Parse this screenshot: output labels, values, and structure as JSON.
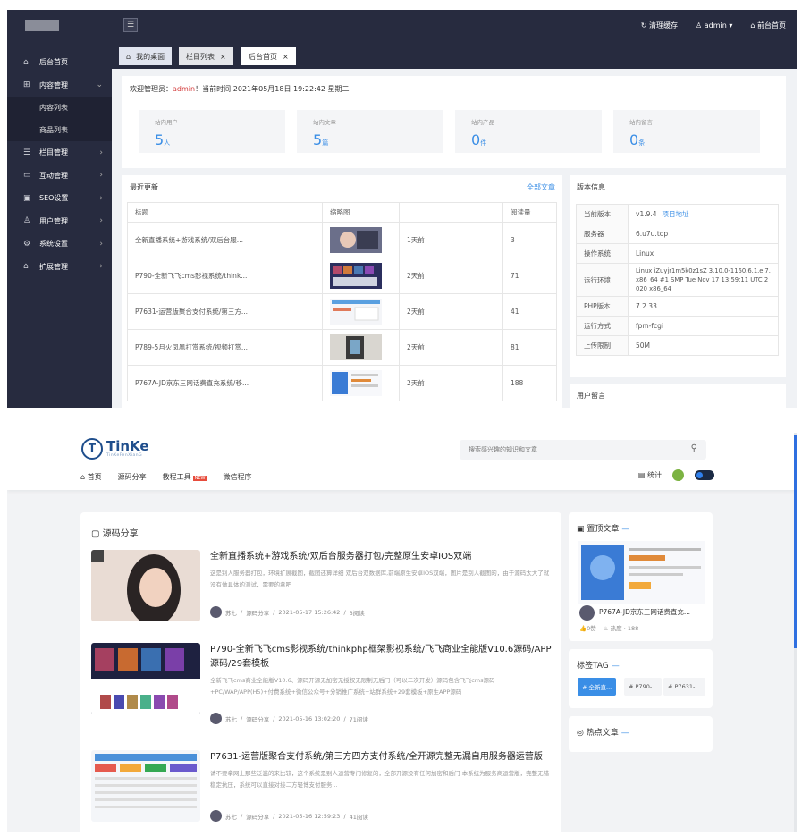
{
  "admin": {
    "topbar": {
      "menu_icon": "menu-icon",
      "clear_cache": "清理缓存",
      "user": "admin",
      "frontend": "前台首页"
    },
    "sidebar": {
      "items": [
        {
          "label": "后台首页",
          "icon": "home-icon"
        },
        {
          "label": "内容管理",
          "icon": "grid-icon",
          "expanded": true
        },
        {
          "label": "内容列表",
          "sub": true
        },
        {
          "label": "商品列表",
          "sub": true
        },
        {
          "label": "栏目管理",
          "icon": "list-icon"
        },
        {
          "label": "互动管理",
          "icon": "chat-icon"
        },
        {
          "label": "SEO设置",
          "icon": "seo-icon"
        },
        {
          "label": "用户管理",
          "icon": "user-icon"
        },
        {
          "label": "系统设置",
          "icon": "gear-icon"
        },
        {
          "label": "扩展管理",
          "icon": "extension-icon"
        }
      ]
    },
    "tabs": [
      {
        "label": "我的桌面"
      },
      {
        "label": "栏目列表"
      },
      {
        "label": "后台首页"
      }
    ],
    "welcome": {
      "prefix": "欢迎管理员：",
      "user": "admin",
      "suffix": "！当前时间:2021年05月18日 19:22:42 星期二"
    },
    "stats": [
      {
        "label": "站内用户",
        "value": "5",
        "unit": "人"
      },
      {
        "label": "站内文章",
        "value": "5",
        "unit": "篇"
      },
      {
        "label": "站内产品",
        "value": "0",
        "unit": "件"
      },
      {
        "label": "站内留言",
        "value": "0",
        "unit": "条"
      }
    ],
    "recent": {
      "title": "最近更新",
      "all_link": "全部文章",
      "columns": [
        "标题",
        "缩略图",
        "",
        "阅读量"
      ],
      "rows": [
        {
          "title": "全新直播系统+游戏系统/双后台服...",
          "time": "1天前",
          "views": "3"
        },
        {
          "title": "P790-全新飞飞cms影视系统/think...",
          "time": "2天前",
          "views": "71"
        },
        {
          "title": "P7631-运营版聚合支付系统/第三方...",
          "time": "2天前",
          "views": "41"
        },
        {
          "title": "P789-5月火凤凰打赏系统/视频打赏...",
          "time": "2天前",
          "views": "81"
        },
        {
          "title": "P767A-JD京东三网话费直充系统/移...",
          "time": "2天前",
          "views": "188"
        }
      ]
    },
    "version": {
      "title": "版本信息",
      "rows": [
        {
          "k": "当前版本",
          "v": "v1.9.4",
          "link": "项目地址"
        },
        {
          "k": "服务器",
          "v": "6.u7u.top"
        },
        {
          "k": "操作系统",
          "v": "Linux"
        },
        {
          "k": "运行环境",
          "v": "Linux iZuyjr1m5k0z1sZ 3.10.0-1160.6.1.el7.x86_64 #1 SMP Tue Nov 17 13:59:11 UTC 2020 x86_64"
        },
        {
          "k": "PHP版本",
          "v": "7.2.33"
        },
        {
          "k": "运行方式",
          "v": "fpm-fcgi"
        },
        {
          "k": "上传限制",
          "v": "50M"
        }
      ]
    },
    "messages": {
      "title": "用户留言"
    }
  },
  "site": {
    "brand": {
      "mark": "T",
      "name": "TinKe",
      "sub": "TinKeFenXianG"
    },
    "search": {
      "placeholder": "搜索感兴趣的知识和文章"
    },
    "nav": [
      {
        "label": "首页",
        "icon": "home-icon"
      },
      {
        "label": "源码分享"
      },
      {
        "label": "教程工具",
        "badge": "NEW"
      },
      {
        "label": "微信程序"
      }
    ],
    "stats_label": "统计",
    "section_title": "源码分享",
    "posts": [
      {
        "title": "全新直播系统+游戏系统/双后台服务器打包/完整原生安卓IOS双端",
        "excerpt": "这是别人服务器打包，环境扩展截图，截图还算详细 双后台双数据库,前端原生安卓IOS双端，图片是别人截图的，由于源码太大了就没有做具体的测试，需要的拿吧",
        "author": "苏七",
        "category": "源码分享",
        "date": "2021-05-17 15:26:42",
        "reads": "3阅读"
      },
      {
        "title": "P790-全新飞飞cms影视系统/thinkphp框架影视系统/飞飞商业全能版V10.6源码/APP源码/29套模板",
        "excerpt": "全新飞飞cms商业全能版V10.6、源码开源无加密无授权无限制无后门（可以二次开发）源码包含飞飞cms源码+PC/WAP/APP(H5)+付费系统+微信公众号+分销推广系统+站群系统+29套模板+原生APP源码",
        "author": "苏七",
        "category": "源码分享",
        "date": "2021-05-16 13:02:20",
        "reads": "71阅读"
      },
      {
        "title": "P7631-运营版聚合支付系统/第三方四方支付系统/全开源完整无漏自用服务器运营版",
        "excerpt": "请不要拿网上那些泛滥的来比较，这个系统是别人运营专门修复的，全部开源没有任何加密和后门 本系统为服务商运营版，完整无错稳定抗压，系统可以直接对接二方轻博支付服务...",
        "author": "苏七",
        "category": "源码分享",
        "date": "2021-05-16 12:59:23",
        "reads": "41阅读"
      }
    ],
    "sticky": {
      "title": "置顶文章",
      "caption": "P767A-JD京东三网话费直充...",
      "likes": "0赞",
      "views": "热度 · 188"
    },
    "tags": {
      "title": "标签TAG",
      "items": [
        "# 全新直...",
        "# P790-...",
        "# P7631-..."
      ]
    },
    "hot": {
      "title": "热点文章"
    }
  }
}
